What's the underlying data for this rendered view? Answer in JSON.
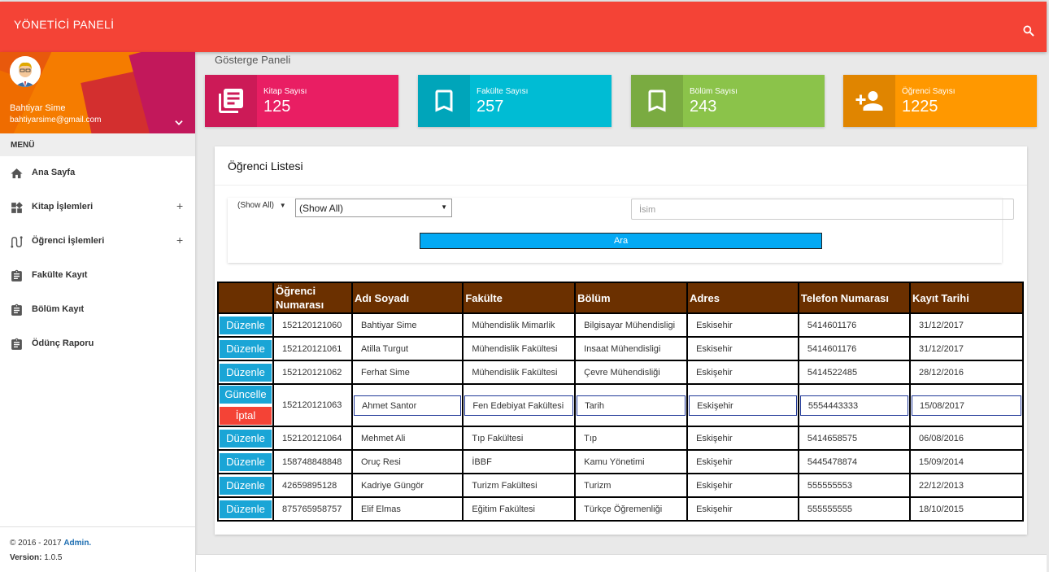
{
  "app": {
    "title": "YÖNETİCİ PANELİ"
  },
  "user": {
    "name": "Bahtiyar Sime",
    "email": "bahtiyarsime@gmail.com"
  },
  "menu": {
    "header": "MENÜ",
    "items": [
      {
        "label": "Ana Sayfa",
        "icon": "home-icon"
      },
      {
        "label": "Kitap İşlemleri",
        "icon": "widgets-icon",
        "expand": "+"
      },
      {
        "label": "Öğrenci İşlemleri",
        "icon": "route-icon",
        "expand": "+"
      },
      {
        "label": "Fakülte Kayıt",
        "icon": "clipboard-icon"
      },
      {
        "label": "Bölüm Kayıt",
        "icon": "clipboard-icon"
      },
      {
        "label": "Ödünç Raporu",
        "icon": "clipboard-icon"
      }
    ]
  },
  "footer": {
    "copyright": "© 2016 - 2017",
    "admin_link": "Admin.",
    "version_label": "Version:",
    "version": "1.0.5"
  },
  "page_title": "Gösterge Paneli",
  "stats": [
    {
      "label": "Kitap Sayısı",
      "value": "125",
      "color": "#e91e63"
    },
    {
      "label": "Fakülte Sayısı",
      "value": "257",
      "color": "#00bcd4"
    },
    {
      "label": "Bölüm Sayısı",
      "value": "243",
      "color": "#8bc34a"
    },
    {
      "label": "Öğrenci Sayısı",
      "value": "1225",
      "color": "#ff9800"
    }
  ],
  "student_list": {
    "title": "Öğrenci Listesi",
    "filter": {
      "select_small": "(Show All)",
      "select_large": "(Show All)",
      "name_placeholder": "İsim",
      "search_button": "Ara"
    },
    "columns": [
      "",
      "Öğrenci Numarası",
      "Adı Soyadı",
      "Fakülte",
      "Bölüm",
      "Adres",
      "Telefon Numarası",
      "Kayıt Tarihi"
    ],
    "edit_label": "Düzenle",
    "update_label": "Güncelle",
    "cancel_label": "İptal",
    "rows": [
      {
        "no": "152120121060",
        "name": "Bahtiyar Sime",
        "faculty": "Mühendislik Mimarlik",
        "dept": "Bilgisayar Mühendisligi",
        "addr": "Eskisehir",
        "phone": "5414601176",
        "date": "31/12/2017"
      },
      {
        "no": "152120121061",
        "name": "Atilla Turgut",
        "faculty": "Mühendislik Fakültesi",
        "dept": "Insaat Mühendisligi",
        "addr": "Eskisehir",
        "phone": "5414601176",
        "date": "31/12/2017"
      },
      {
        "no": "152120121062",
        "name": "Ferhat Sime",
        "faculty": "Mühendislik Fakültesi",
        "dept": "Çevre Mühendisliği",
        "addr": "Eskişehir",
        "phone": "5414522485",
        "date": "28/12/2016"
      },
      {
        "no": "152120121063",
        "name": "Ahmet Santor",
        "faculty": "Fen Edebiyat Fakültesi",
        "dept": "Tarih",
        "addr": "Eskişehir",
        "phone": "5554443333",
        "date": "15/08/2017",
        "editing": true
      },
      {
        "no": "152120121064",
        "name": "Mehmet Ali",
        "faculty": "Tıp Fakültesi",
        "dept": "Tıp",
        "addr": "Eskişehir",
        "phone": "5414658575",
        "date": "06/08/2016"
      },
      {
        "no": "158748848848",
        "name": "Oruç Resi",
        "faculty": "İBBF",
        "dept": "Kamu Yönetimi",
        "addr": "Eskişehir",
        "phone": "5445478874",
        "date": "15/09/2014"
      },
      {
        "no": "42659895128",
        "name": "Kadriye Güngör",
        "faculty": "Turizm Fakültesi",
        "dept": "Turizm",
        "addr": "Eskişehir",
        "phone": "555555553",
        "date": "22/12/2013"
      },
      {
        "no": "875765958757",
        "name": "Elif Elmas",
        "faculty": "Eğitim Fakültesi",
        "dept": "Türkçe Öğremenliği",
        "addr": "Eskişehir",
        "phone": "555555555",
        "date": "18/10/2015"
      }
    ]
  }
}
